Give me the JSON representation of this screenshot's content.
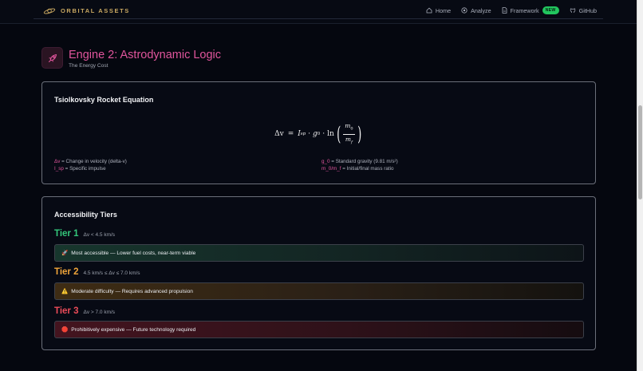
{
  "nav": {
    "brand": "ORBITAL ASSETS",
    "links": [
      {
        "label": "Home",
        "icon": "home-icon"
      },
      {
        "label": "Analyze",
        "icon": "analyze-icon"
      },
      {
        "label": "Framework",
        "icon": "document-icon",
        "badge": "NEW"
      },
      {
        "label": "GitHub",
        "icon": "github-icon"
      }
    ]
  },
  "engine": {
    "title": "Engine 2: Astrodynamic Logic",
    "subtitle": "The Energy Cost",
    "icon": "rocket-icon"
  },
  "equation_card": {
    "title": "Tsiolkovsky Rocket Equation",
    "formula": {
      "lhs": "Δv",
      "eq": "=",
      "isp": "I",
      "isp_sub": "sp",
      "dot1": "·",
      "g": "g",
      "g_sub": "0",
      "dot2": "·",
      "ln": "ln",
      "num": "m",
      "num_sub": "0",
      "den": "m",
      "den_sub": "f"
    },
    "definitions": [
      {
        "key": "Δv",
        "text": " = Change in velocity (delta-v)"
      },
      {
        "key": "I_sp",
        "text": " = Specific impulse"
      },
      {
        "key": "g_0",
        "text": " = Standard gravity (9.81 m/s²)"
      },
      {
        "key": "m_0/m_f",
        "text": " = Initial/final mass ratio"
      }
    ]
  },
  "tiers_card": {
    "title": "Accessibility Tiers",
    "tiers": [
      {
        "name": "Tier 1",
        "range": "Δv < 4.5 km/s",
        "icon": "rocket-emoji-icon",
        "glyph": "🚀",
        "text": "Most accessible — Lower fuel costs, near-term viable",
        "color": "#34c77b"
      },
      {
        "name": "Tier 2",
        "range": "4.5 km/s ≤ Δv ≤ 7.0 km/s",
        "icon": "warning-icon",
        "glyph": "⚠️",
        "text": "Moderate difficulty — Requires advanced propulsion",
        "color": "#f0a53a"
      },
      {
        "name": "Tier 3",
        "range": "Δv > 7.0 km/s",
        "icon": "stop-icon",
        "glyph": "🛑",
        "text": "Prohibitively expensive — Future technology required",
        "color": "#ec4b59"
      }
    ]
  },
  "colors": {
    "accent": "#e0559c",
    "brand": "#c9a861",
    "badge": "#22c55e"
  }
}
